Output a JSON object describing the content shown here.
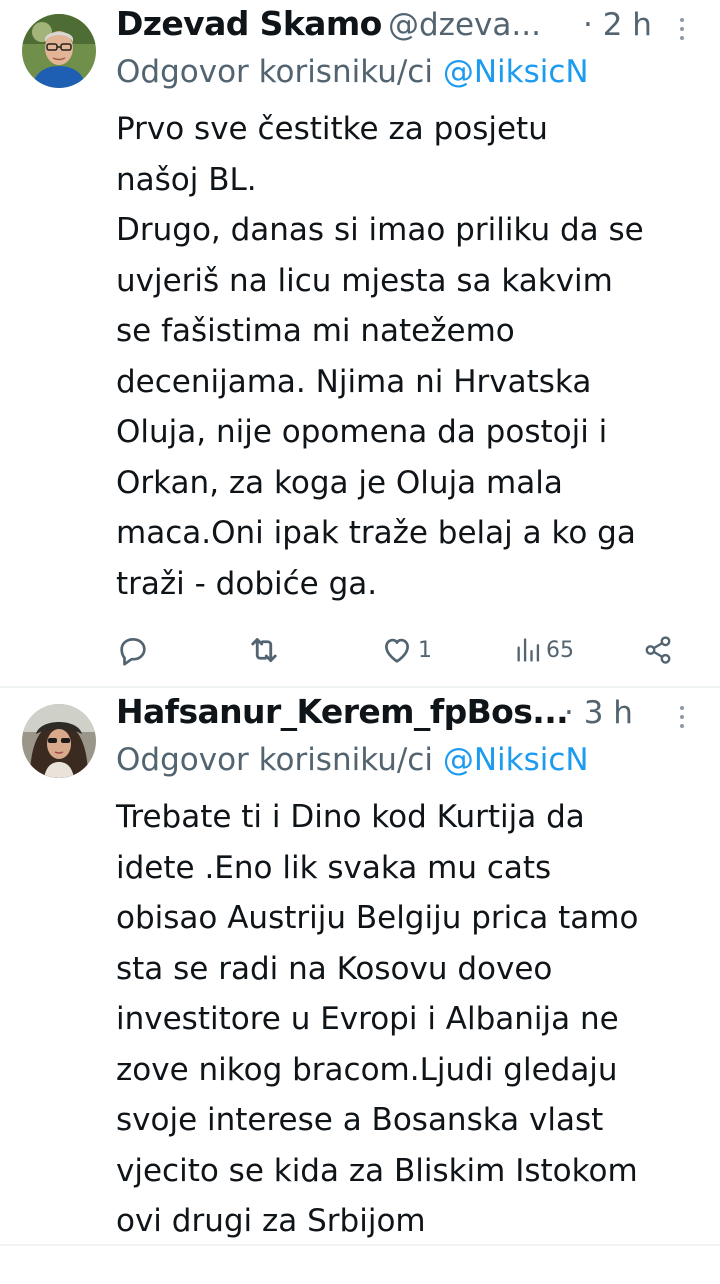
{
  "tweets": [
    {
      "name": "Dzevad Skamo",
      "handle": "@dzeva...",
      "time": "· 2 h",
      "reply_prefix": "Odgovor korisniku/ci ",
      "reply_mention": "@NiksicN",
      "text": "Prvo sve čestitke za posjetu\nnašoj BL.\nDrugo, danas si imao priliku da se\nuvjeriš na licu mjesta sa kakvim\nse fašistima mi natežemo\ndecenijama. Njima ni Hrvatska\nOluja, nije opomena da postoji i\nOrkan, za koga je Oluja mala\nmaca.Oni ipak traže belaj a ko ga\ntraži - dobiće ga.",
      "likes": "1",
      "views": "65"
    },
    {
      "name": "Hafsanur_Kerem_fpBos...",
      "handle": "",
      "time": "· 3 h",
      "reply_prefix": "Odgovor korisniku/ci ",
      "reply_mention": "@NiksicN",
      "text": "Trebate ti i Dino kod Kurtija da\nidete .Eno lik svaka mu cats\nobisao Austriju Belgiju prica tamo\nsta se radi na Kosovu doveo\ninvestitore u Evropi i Albanija ne\nzove nikog bracom.Ljudi gledaju\nsvoje interese a Bosanska vlast\nvjecito se kida za Bliskim Istokom\novi drugi za Srbijom"
    }
  ],
  "icons": {
    "reply": "reply-icon",
    "retweet": "retweet-icon",
    "like": "heart-icon",
    "views": "views-icon",
    "share": "share-icon",
    "more": "more-icon"
  },
  "colors": {
    "accent": "#1d9bf0",
    "secondary_text": "#536471",
    "divider": "#eff3f4"
  }
}
